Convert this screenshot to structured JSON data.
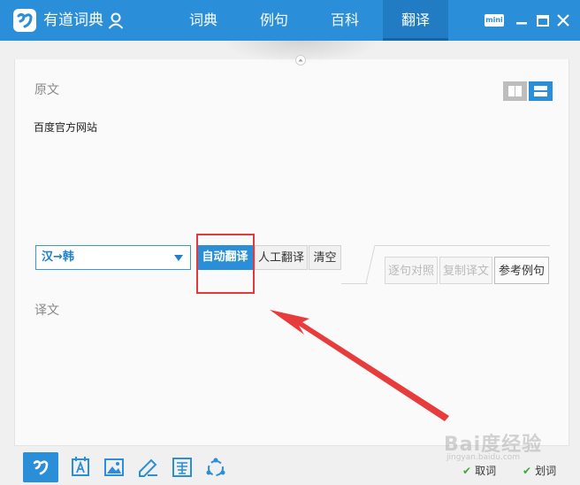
{
  "app": {
    "title": "有道词典",
    "mini_label": "mini"
  },
  "nav": {
    "tabs": [
      {
        "label": "词典"
      },
      {
        "label": "例句"
      },
      {
        "label": "百科"
      },
      {
        "label": "翻译"
      }
    ],
    "active": "翻译"
  },
  "source": {
    "label": "原文",
    "text": "百度官方网站"
  },
  "toolbar": {
    "language": "汉→韩",
    "auto_translate": "自动翻译",
    "manual_translate": "人工翻译",
    "clear": "清空",
    "compare": "逐句对照",
    "copy": "复制译文",
    "reference": "参考例句"
  },
  "target": {
    "label": "译文"
  },
  "bottom": {
    "options": [
      {
        "label": "取词"
      },
      {
        "label": "划词"
      }
    ]
  },
  "watermark": {
    "text": "Bai度经验",
    "sub": "jingyan.baidu.com"
  },
  "colors": {
    "brand": "#2b8ed8",
    "annotation": "#e23a3a"
  }
}
